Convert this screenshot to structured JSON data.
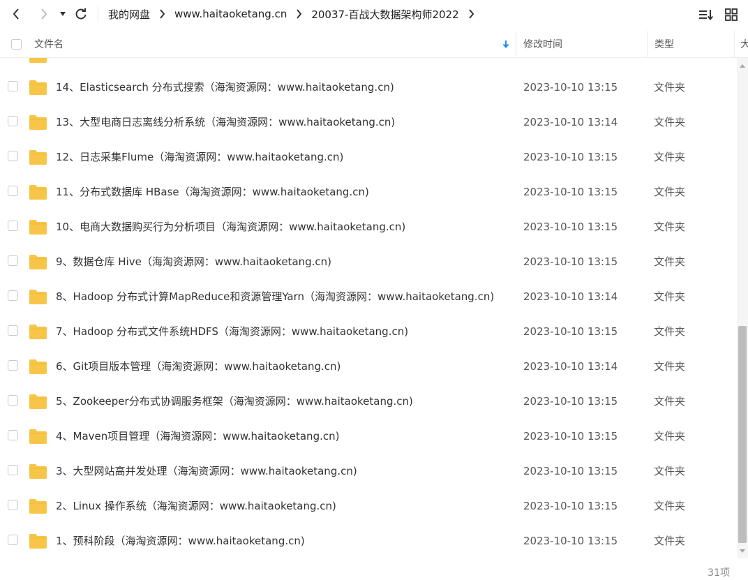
{
  "nav": {
    "back_icon": "chevron-left-icon",
    "forward_icon": "chevron-right-icon",
    "history_icon": "caret-down-icon",
    "refresh_icon": "refresh-icon",
    "breadcrumb": [
      "我的网盘",
      "www.haitaoketang.cn",
      "20037-百战大数据架构师2022"
    ],
    "sort_icon": "sort-list-icon",
    "view_icon": "grid-view-icon"
  },
  "columns": {
    "name": "文件名",
    "modified": "修改时间",
    "type": "类型",
    "size": "大"
  },
  "colors": {
    "folder": "#f7c548",
    "sort_arrow": "#1a8cff",
    "scroll_thumb": "#bdbdbd"
  },
  "files": [
    {
      "name": "14、Elasticsearch 分布式搜索（海淘资源网：www.haitaoketang.cn)",
      "modified": "2023-10-10 13:15",
      "type": "文件夹"
    },
    {
      "name": "13、大型电商日志离线分析系统（海淘资源网：www.haitaoketang.cn)",
      "modified": "2023-10-10 13:14",
      "type": "文件夹"
    },
    {
      "name": "12、日志采集Flume（海淘资源网：www.haitaoketang.cn)",
      "modified": "2023-10-10 13:15",
      "type": "文件夹"
    },
    {
      "name": "11、分布式数据库 HBase（海淘资源网：www.haitaoketang.cn)",
      "modified": "2023-10-10 13:15",
      "type": "文件夹"
    },
    {
      "name": "10、电商大数据购买行为分析项目（海淘资源网：www.haitaoketang.cn)",
      "modified": "2023-10-10 13:15",
      "type": "文件夹"
    },
    {
      "name": "9、数据仓库 Hive（海淘资源网：www.haitaoketang.cn)",
      "modified": "2023-10-10 13:15",
      "type": "文件夹"
    },
    {
      "name": "8、Hadoop 分布式计算MapReduce和资源管理Yarn（海淘资源网：www.haitaoketang.cn)",
      "modified": "2023-10-10 13:14",
      "type": "文件夹"
    },
    {
      "name": "7、Hadoop 分布式文件系统HDFS（海淘资源网：www.haitaoketang.cn)",
      "modified": "2023-10-10 13:15",
      "type": "文件夹"
    },
    {
      "name": "6、Git项目版本管理（海淘资源网：www.haitaoketang.cn)",
      "modified": "2023-10-10 13:14",
      "type": "文件夹"
    },
    {
      "name": "5、Zookeeper分布式协调服务框架（海淘资源网：www.haitaoketang.cn)",
      "modified": "2023-10-10 13:15",
      "type": "文件夹"
    },
    {
      "name": "4、Maven项目管理（海淘资源网：www.haitaoketang.cn)",
      "modified": "2023-10-10 13:15",
      "type": "文件夹"
    },
    {
      "name": "3、大型网站高并发处理（海淘资源网：www.haitaoketang.cn)",
      "modified": "2023-10-10 13:15",
      "type": "文件夹"
    },
    {
      "name": "2、Linux 操作系统（海淘资源网：www.haitaoketang.cn)",
      "modified": "2023-10-10 13:15",
      "type": "文件夹"
    },
    {
      "name": "1、预科阶段（海淘资源网：www.haitaoketang.cn)",
      "modified": "2023-10-10 13:15",
      "type": "文件夹"
    }
  ],
  "footer": {
    "count": "31项"
  }
}
